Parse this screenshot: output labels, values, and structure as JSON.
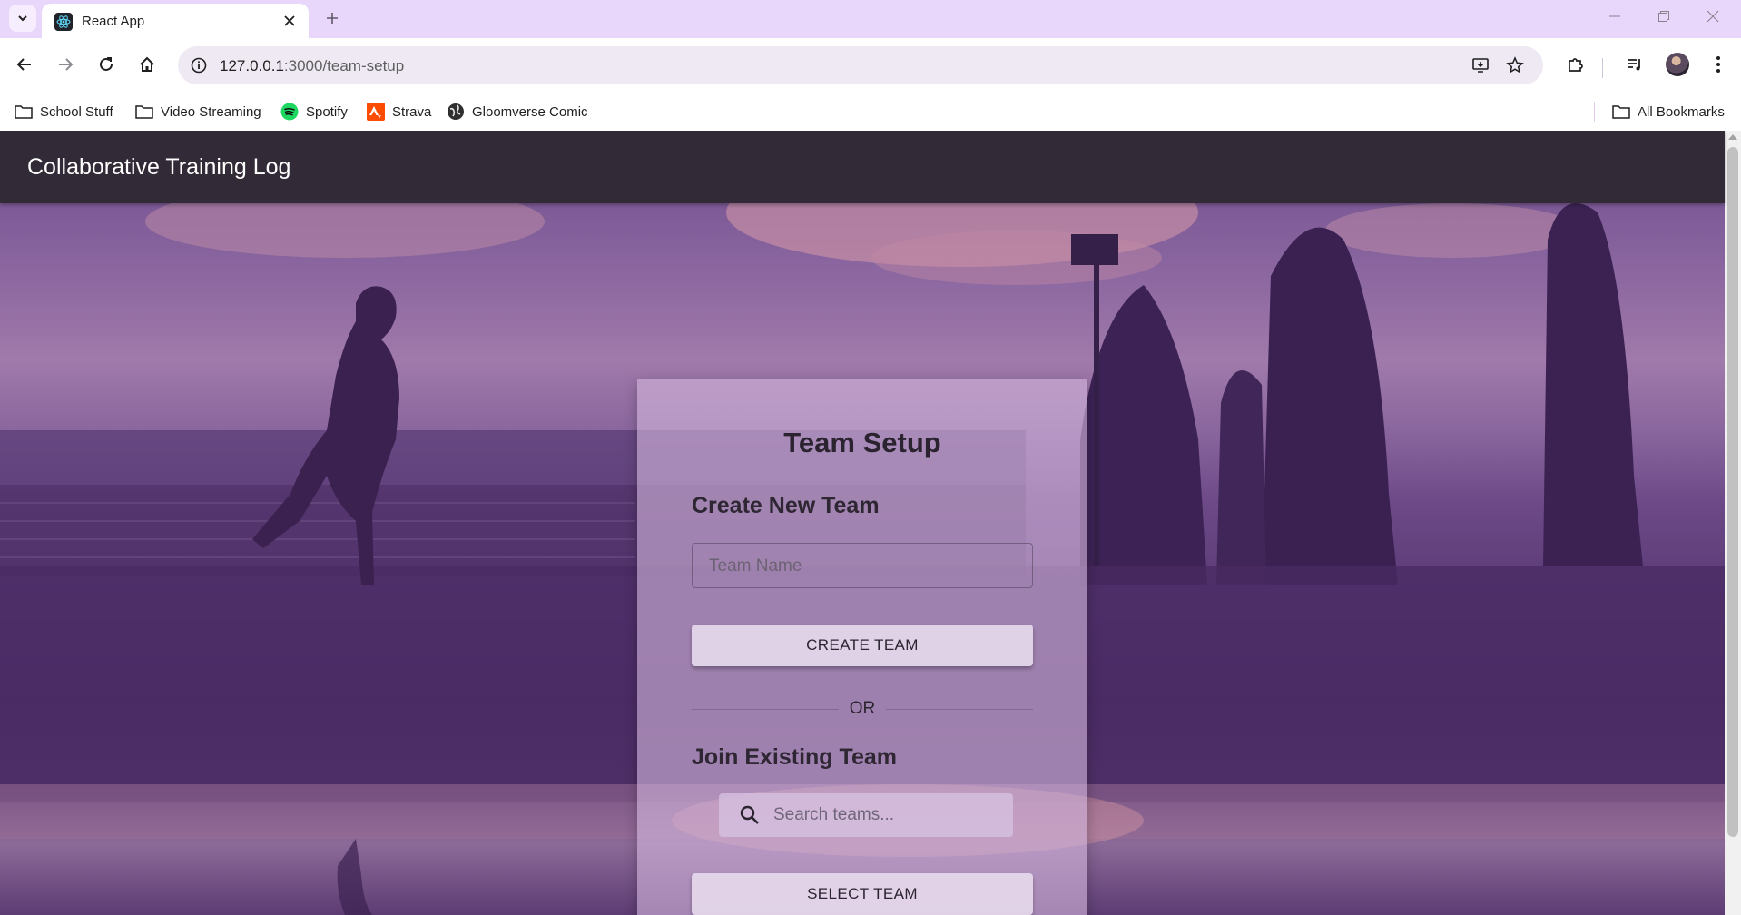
{
  "browser": {
    "tab_title": "React App",
    "url_host": "127.0.0.1",
    "url_rest": ":3000/team-setup",
    "bookmarks": [
      {
        "label": "School Stuff",
        "icon": "folder-icon"
      },
      {
        "label": "Video Streaming",
        "icon": "folder-icon"
      },
      {
        "label": "Spotify",
        "icon": "spotify-icon"
      },
      {
        "label": "Strava",
        "icon": "strava-icon"
      },
      {
        "label": "Gloomverse Comic",
        "icon": "globe-icon"
      }
    ],
    "all_bookmarks": "All Bookmarks"
  },
  "app": {
    "title": "Collaborative Training Log"
  },
  "team_setup": {
    "title": "Team Setup",
    "create_heading": "Create New Team",
    "team_name_placeholder": "Team Name",
    "create_button": "CREATE TEAM",
    "or_text": "OR",
    "join_heading": "Join Existing Team",
    "search_placeholder": "Search teams...",
    "select_button": "SELECT TEAM"
  },
  "colors": {
    "tabbar": "#e9d7fb",
    "appbar": "#322a36",
    "card": "#d2b4dc"
  }
}
